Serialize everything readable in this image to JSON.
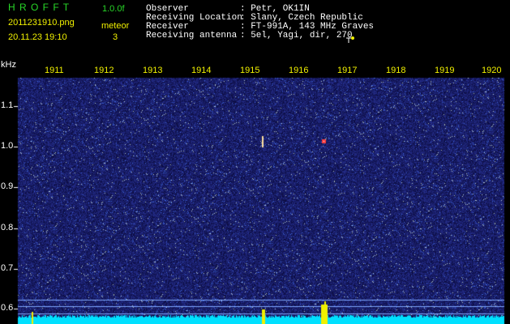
{
  "header": {
    "program": "H R O F F T",
    "version": "1.0.0f",
    "filename": "2011231910.png",
    "datetime": "20.11.23 19:10",
    "mode_label": "meteor",
    "count": "3"
  },
  "station": {
    "labels": [
      "Observer",
      "Receiving Location",
      "Receiver",
      "Receiving antenna"
    ],
    "values": [
      ": Petr, OK1IN",
      ": Slany, Czech Republic",
      ": FT-991A, 143 MHz Graves",
      ": 5el, Yagi, dir, 270"
    ]
  },
  "axis": {
    "y_unit": "kHz",
    "y_ticks": [
      "1.1",
      "1.0",
      "0.9",
      "0.8",
      "0.7",
      "0.6"
    ],
    "x_ticks": [
      "1911",
      "1912",
      "1913",
      "1914",
      "1915",
      "1916",
      "1917",
      "1918",
      "1919",
      "1920"
    ]
  },
  "colors": {
    "background": "#000000",
    "noise": "#1a2a8a",
    "text_green": "#28d828",
    "text_yellow": "#f0f000",
    "baseline": "#00e0ff"
  }
}
